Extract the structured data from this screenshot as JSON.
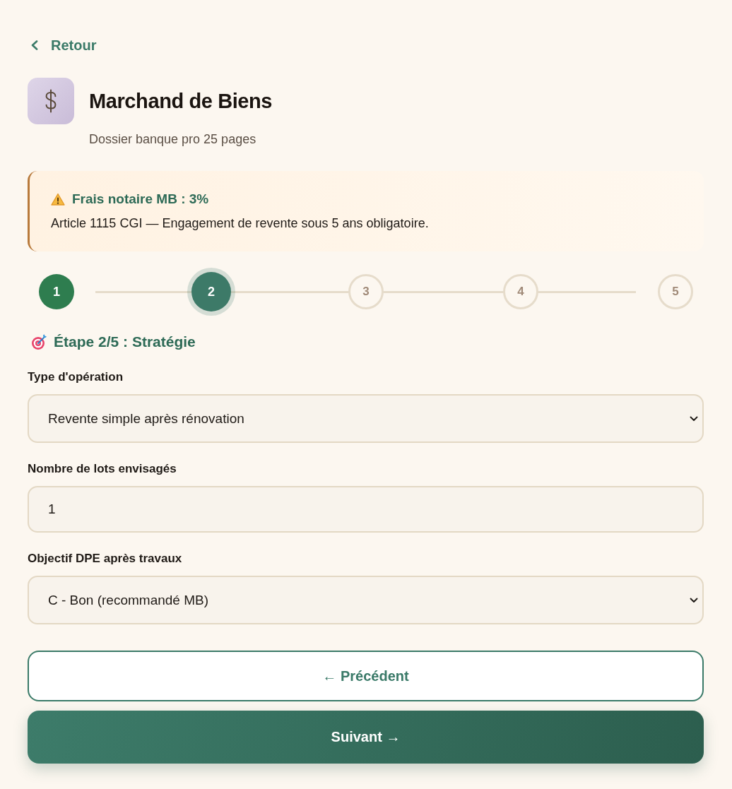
{
  "back_link": {
    "label": "Retour"
  },
  "header": {
    "title": "Marchand de Biens",
    "subtitle": "Dossier banque pro 25 pages"
  },
  "alert": {
    "title": "Frais notaire MB : 3%",
    "text": "Article 1115 CGI — Engagement de revente sous 5 ans obligatoire."
  },
  "stepper": {
    "steps": [
      {
        "label": "1",
        "completed": true,
        "selected": false
      },
      {
        "label": "2",
        "completed": false,
        "selected": true
      },
      {
        "label": "3",
        "completed": false,
        "selected": false
      },
      {
        "label": "4",
        "completed": false,
        "selected": false
      },
      {
        "label": "5",
        "completed": false,
        "selected": false
      }
    ]
  },
  "step_heading": "Étape 2/5 : Stratégie",
  "fields": [
    {
      "kind": "select",
      "label": "Type d'opération",
      "value": "Revente simple après rénovation"
    },
    {
      "kind": "number",
      "label": "Nombre de lots envisagés",
      "value": "1"
    },
    {
      "kind": "select",
      "label": "Objectif DPE après travaux",
      "value": "C - Bon (recommandé MB)"
    }
  ],
  "buttons": [
    {
      "kind": "secondary",
      "label": "← Précédent"
    },
    {
      "kind": "primary",
      "label": "Suivant →"
    }
  ]
}
